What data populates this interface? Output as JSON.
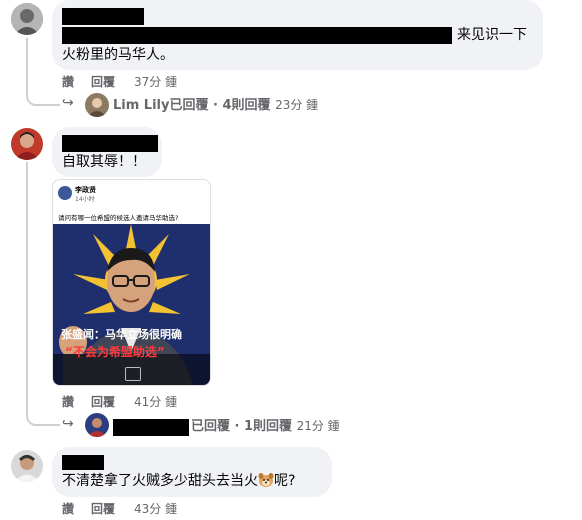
{
  "comments": [
    {
      "text_suffix": "来见识一下",
      "text_line2": "火粉里的马华人。",
      "actions": {
        "like": "讚",
        "reply": "回覆",
        "time": "37分 鍾"
      },
      "replies": {
        "name": "Lim Lily",
        "suffix": "已回覆 · 4則回覆",
        "time": "23分 鍾"
      }
    },
    {
      "text": "自取其辱！！",
      "image": {
        "poster_name": "李政贤",
        "poster_time": "14小时",
        "post_text": "请问有哪一位希盟的候选人邀请马华助选?",
        "headline": "张盛闻：马华立场很明确",
        "quote": "“不会为希盟助选”"
      },
      "actions": {
        "like": "讚",
        "reply": "回覆",
        "time": "41分 鍾"
      },
      "replies": {
        "suffix": "已回覆 · 1則回覆",
        "time": "21分 鍾"
      }
    },
    {
      "text_prefix": "不清楚拿了火贼多少甜头去当火",
      "text_suffix": "呢?",
      "actions": {
        "like": "讚",
        "reply": "回覆",
        "time": "43分 鍾"
      }
    }
  ]
}
